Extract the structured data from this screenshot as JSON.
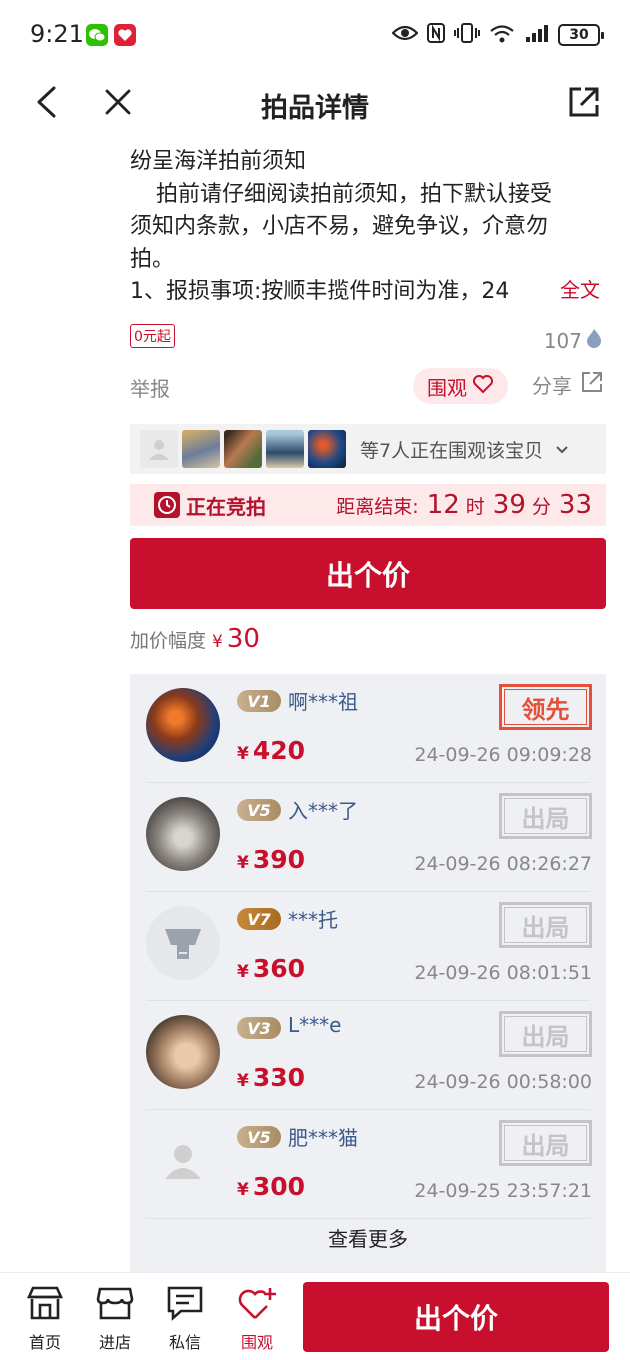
{
  "status_bar": {
    "time": "9:21",
    "battery": "30",
    "icons": [
      "wechat-icon",
      "app-icon",
      "eye-icon",
      "nfc-icon",
      "vibrate-icon",
      "wifi-icon",
      "signal-icon",
      "battery-icon"
    ]
  },
  "nav": {
    "title": "拍品详情",
    "back_icon": "back-icon",
    "close_icon": "close-icon",
    "share_icon": "share-out-icon"
  },
  "notice": {
    "title": "纷呈海洋拍前须知",
    "line1": "拍前请仔细阅读拍前须知，拍下默认接受",
    "line2": "须知内条款，小店不易，避免争议，介意勿",
    "line3": "拍。",
    "line4": "1、报损事项:按顺丰揽件时间为准，24",
    "full_text": "全文"
  },
  "tags": {
    "start_price": "0元起",
    "view_count": "107"
  },
  "actions": {
    "report": "举报",
    "watch": "围观",
    "share": "分享"
  },
  "watchers": {
    "text": "等7人正在围观该宝贝"
  },
  "auction_status": {
    "label": "正在竞拍",
    "countdown_label": "距离结束:",
    "hours": "12",
    "hours_unit": "时",
    "minutes": "39",
    "minutes_unit": "分",
    "seconds": "33"
  },
  "bid_button": "出个价",
  "increment": {
    "label": "加价幅度",
    "currency": "¥",
    "value": "30"
  },
  "currency_symbol": "¥",
  "records": [
    {
      "vip": "V1",
      "name": "啊***祖",
      "price": "420",
      "time": "24-09-26 09:09:28",
      "stamp": "领先"
    },
    {
      "vip": "V5",
      "name": "入***了",
      "price": "390",
      "time": "24-09-26 08:26:27",
      "stamp": "出局"
    },
    {
      "vip": "V7",
      "name": "***托",
      "price": "360",
      "time": "24-09-26 08:01:51",
      "stamp": "出局"
    },
    {
      "vip": "V3",
      "name": "L***e",
      "price": "330",
      "time": "24-09-26 00:58:00",
      "stamp": "出局"
    },
    {
      "vip": "V5",
      "name": "肥***猫",
      "price": "300",
      "time": "24-09-25 23:57:21",
      "stamp": "出局"
    }
  ],
  "see_more": "查看更多",
  "bottom_nav": [
    {
      "label": "首页",
      "icon": "home-icon"
    },
    {
      "label": "进店",
      "icon": "shop-icon"
    },
    {
      "label": "私信",
      "icon": "message-icon"
    },
    {
      "label": "围观",
      "icon": "heart-plus-icon"
    }
  ],
  "bottom_bid_button": "出个价",
  "colors": {
    "accent": "#c8102e",
    "lead_stamp": "#e4503a",
    "out_stamp": "#c4c4c4",
    "record_bg": "#eef0f3"
  }
}
